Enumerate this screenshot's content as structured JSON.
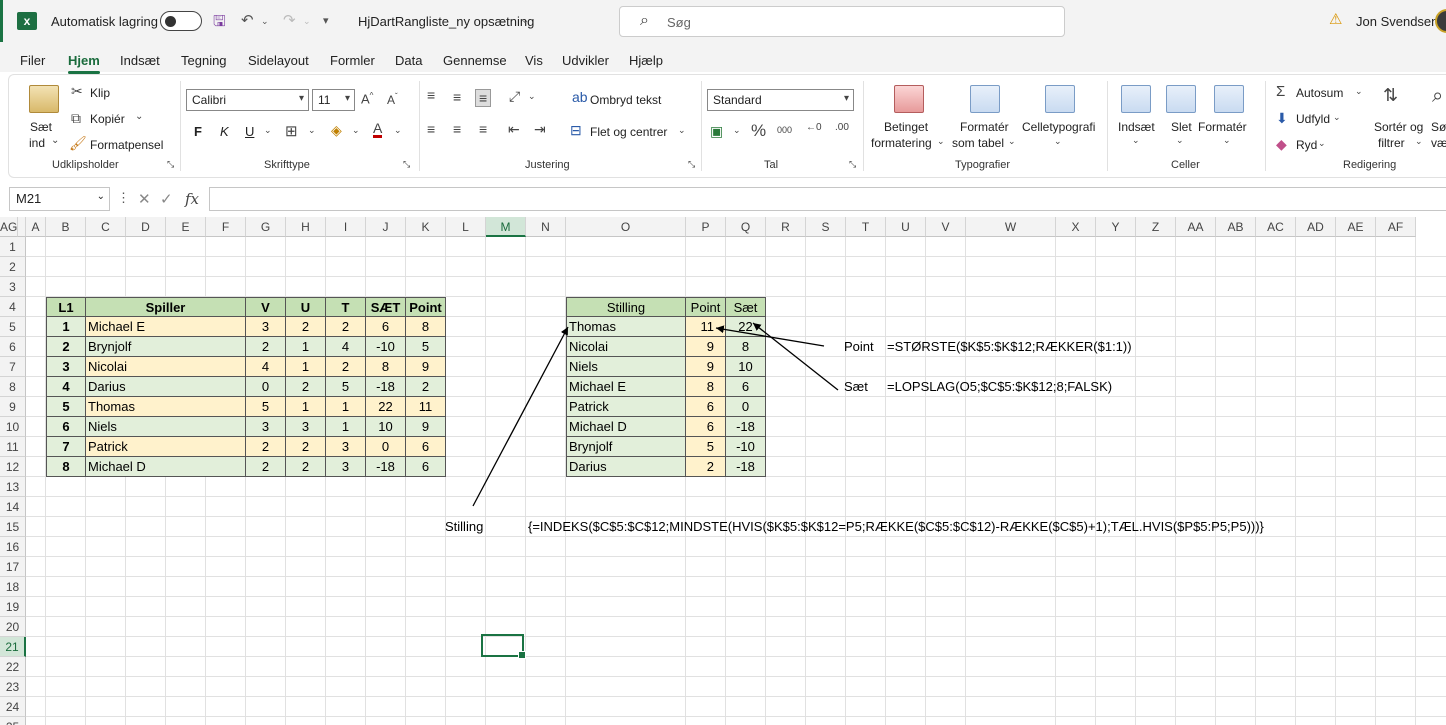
{
  "titlebar": {
    "autosave_label": "Automatisk lagring",
    "filename": "HjDartRangliste_ny opsætning",
    "search_placeholder": "Søg",
    "user": "Jon Svendsen"
  },
  "menu": [
    "Filer",
    "Hjem",
    "Indsæt",
    "Tegning",
    "Sidelayout",
    "Formler",
    "Data",
    "Gennemse",
    "Vis",
    "Udvikler",
    "Hjælp"
  ],
  "menu_active": "Hjem",
  "ribbon": {
    "clipboard": {
      "paste": "Sæt",
      "paste2": "ind",
      "cut": "Klip",
      "copy": "Kopiér",
      "format_painter": "Formatpensel",
      "group": "Udklipsholder"
    },
    "font": {
      "name": "Calibri",
      "size": "11",
      "bold": "F",
      "italic": "K",
      "underline": "U",
      "group": "Skrifttype"
    },
    "alignment": {
      "wrap": "Ombryd tekst",
      "merge": "Flet og centrer",
      "group": "Justering"
    },
    "number": {
      "format": "Standard",
      "group": "Tal"
    },
    "styles": {
      "cond1": "Betinget",
      "cond2": "formatering",
      "table1": "Formatér",
      "table2": "som tabel",
      "cell": "Celletypografi",
      "group": "Typografier"
    },
    "cells": {
      "insert": "Indsæt",
      "delete": "Slet",
      "format": "Formatér",
      "group": "Celler"
    },
    "editing": {
      "autosum": "Autosum",
      "fill": "Udfyld",
      "clear": "Ryd",
      "sort1": "Sortér og",
      "sort2": "filtrer",
      "find1": "Søg",
      "find2": "væ",
      "group": "Redigering"
    }
  },
  "formula_bar": {
    "name_box": "M21",
    "formula": ""
  },
  "columns": [
    "A",
    "B",
    "C",
    "D",
    "E",
    "F",
    "G",
    "H",
    "I",
    "J",
    "K",
    "L",
    "M",
    "N",
    "O",
    "P",
    "Q",
    "R",
    "S",
    "T",
    "U",
    "V",
    "W",
    "X",
    "Y",
    "Z",
    "AA",
    "AB",
    "AC",
    "AD",
    "AE",
    "AF",
    "AG"
  ],
  "rows": [
    "1",
    "2",
    "3",
    "4",
    "5",
    "6",
    "7",
    "8",
    "9",
    "10",
    "11",
    "12",
    "13",
    "14",
    "15",
    "16",
    "17",
    "18",
    "19",
    "20",
    "21",
    "22",
    "23",
    "24",
    "25"
  ],
  "table1": {
    "headers": [
      "L1",
      "Spiller",
      "V",
      "U",
      "T",
      "SÆT",
      "Point"
    ],
    "rows": [
      [
        "1",
        "Michael E",
        "3",
        "2",
        "2",
        "6",
        "8"
      ],
      [
        "2",
        "Brynjolf",
        "2",
        "1",
        "4",
        "-10",
        "5"
      ],
      [
        "3",
        "Nicolai",
        "4",
        "1",
        "2",
        "8",
        "9"
      ],
      [
        "4",
        "Darius",
        "0",
        "2",
        "5",
        "-18",
        "2"
      ],
      [
        "5",
        "Thomas",
        "5",
        "1",
        "1",
        "22",
        "11"
      ],
      [
        "6",
        "Niels",
        "3",
        "3",
        "1",
        "10",
        "9"
      ],
      [
        "7",
        "Patrick",
        "2",
        "2",
        "3",
        "0",
        "6"
      ],
      [
        "8",
        "Michael D",
        "2",
        "2",
        "3",
        "-18",
        "6"
      ]
    ]
  },
  "table2": {
    "headers": [
      "Stilling",
      "Point",
      "Sæt"
    ],
    "rows": [
      [
        "Thomas",
        "11",
        "22"
      ],
      [
        "Nicolai",
        "9",
        "8"
      ],
      [
        "Niels",
        "9",
        "10"
      ],
      [
        "Michael E",
        "8",
        "6"
      ],
      [
        "Patrick",
        "6",
        "0"
      ],
      [
        "Michael D",
        "6",
        "-18"
      ],
      [
        "Brynjolf",
        "5",
        "-10"
      ],
      [
        "Darius",
        "2",
        "-18"
      ]
    ]
  },
  "annotations": {
    "point_label": "Point",
    "point_formula": "=STØRSTE($K$5:$K$12;RÆKKER($1:1))",
    "saet_label": "Sæt",
    "saet_formula": "=LOPSLAG(O5;$C$5:$K$12;8;FALSK)",
    "stilling_label": "Stilling",
    "stilling_formula": "{=INDEKS($C$5:$C$12;MINDSTE(HVIS($K$5:$K$12=P5;RÆKKE($C$5:$C$12)-RÆKKE($C$5)+1);TÆL.HVIS($P$5:P5;P5)))}"
  }
}
